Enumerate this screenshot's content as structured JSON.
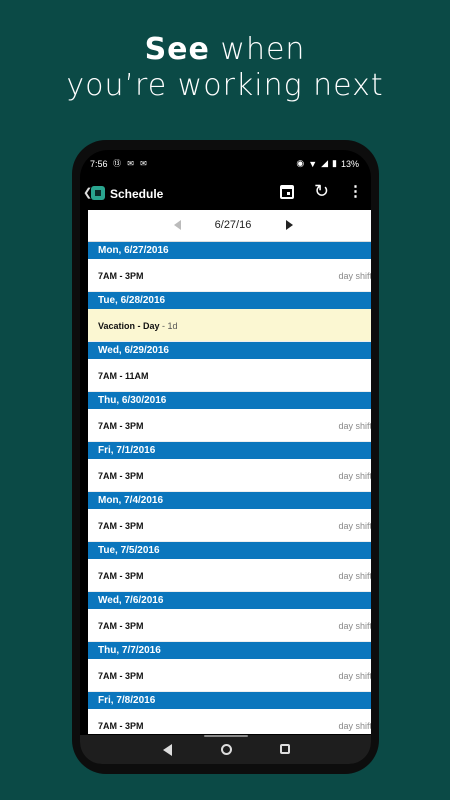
{
  "headline": {
    "strong": "See",
    "rest1": " when",
    "line2": "you’re working next"
  },
  "status": {
    "time": "7:56",
    "left_icons": "⑬ ✉ ✉",
    "battery": "13%"
  },
  "app": {
    "title": "Schedule"
  },
  "date_nav": {
    "date": "6/27/16"
  },
  "days": [
    {
      "header": "Mon, 6/27/2016",
      "time": "7AM - 3PM",
      "duration": "",
      "label": "day shift",
      "vacation": false
    },
    {
      "header": "Tue, 6/28/2016",
      "time": "Vacation - Day",
      "duration": "- 1d",
      "label": "",
      "vacation": true
    },
    {
      "header": "Wed, 6/29/2016",
      "time": "7AM - 11AM",
      "duration": "",
      "label": "",
      "vacation": false
    },
    {
      "header": "Thu, 6/30/2016",
      "time": "7AM - 3PM",
      "duration": "",
      "label": "day shift",
      "vacation": false
    },
    {
      "header": "Fri, 7/1/2016",
      "time": "7AM - 3PM",
      "duration": "",
      "label": "day shift",
      "vacation": false
    },
    {
      "header": "Mon, 7/4/2016",
      "time": "7AM - 3PM",
      "duration": "",
      "label": "day shift",
      "vacation": false
    },
    {
      "header": "Tue, 7/5/2016",
      "time": "7AM - 3PM",
      "duration": "",
      "label": "day shift",
      "vacation": false
    },
    {
      "header": "Wed, 7/6/2016",
      "time": "7AM - 3PM",
      "duration": "",
      "label": "day shift",
      "vacation": false
    },
    {
      "header": "Thu, 7/7/2016",
      "time": "7AM - 3PM",
      "duration": "",
      "label": "day shift",
      "vacation": false
    },
    {
      "header": "Fri, 7/8/2016",
      "time": "7AM - 3PM",
      "duration": "",
      "label": "day shift",
      "vacation": false
    }
  ],
  "icons": {
    "back": "chevron-left-icon",
    "logo": "app-logo-icon",
    "calendar": "calendar-icon",
    "refresh": "refresh-icon",
    "more": "more-vert-icon",
    "prev": "arrow-left-icon",
    "next": "arrow-right-icon"
  },
  "colors": {
    "background": "#0b4a46",
    "day_header": "#0b76bd",
    "vacation_row": "#fbf7d2"
  }
}
